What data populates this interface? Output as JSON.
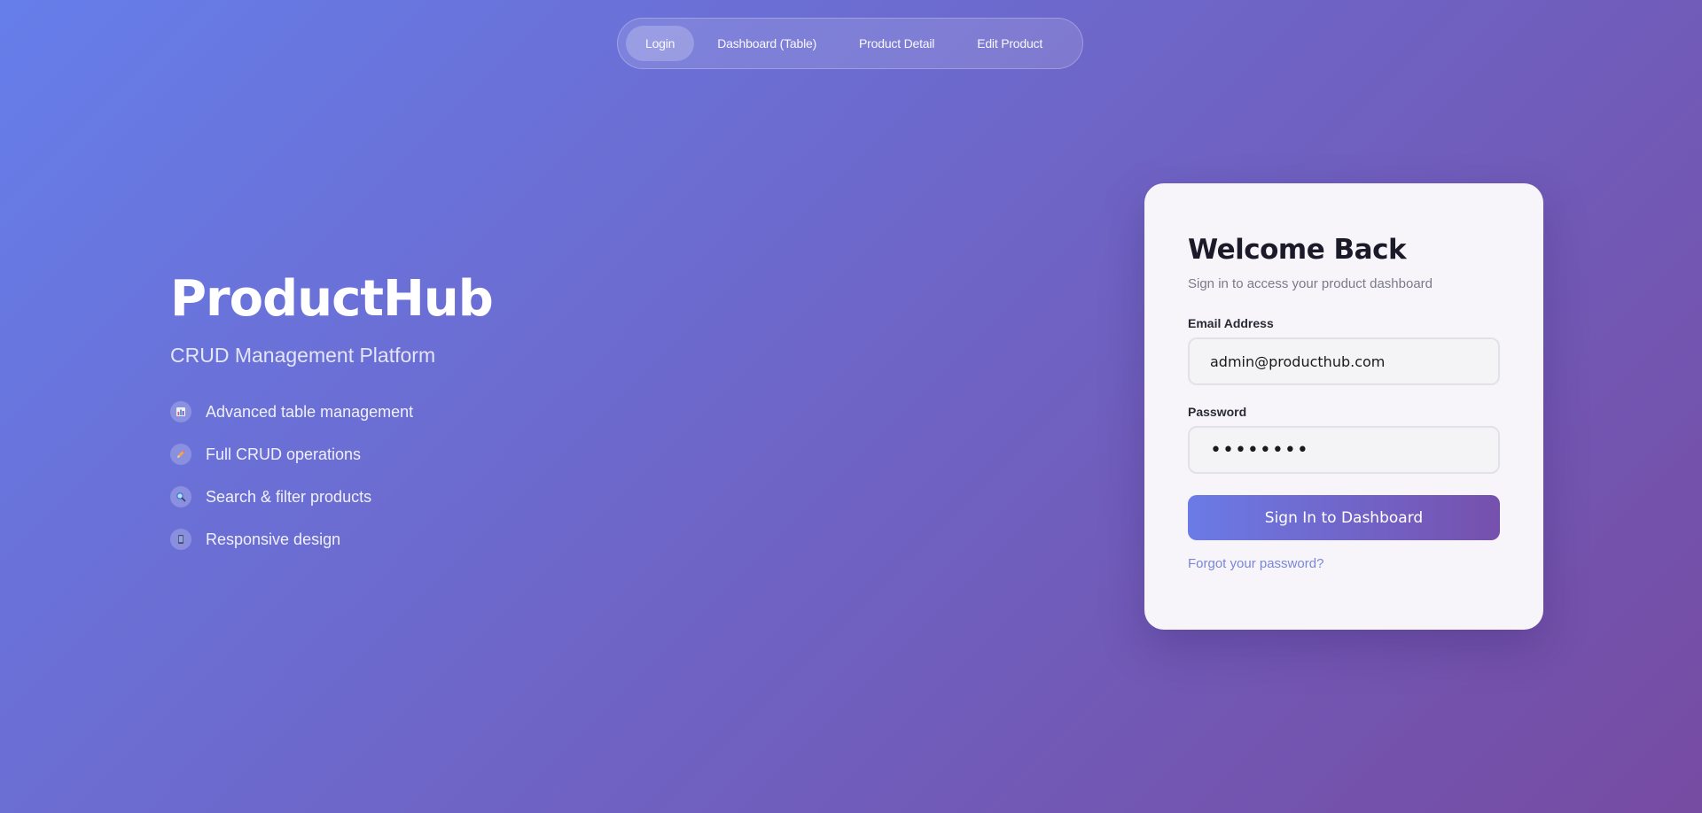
{
  "nav": {
    "items": [
      {
        "label": "Login",
        "active": true
      },
      {
        "label": "Dashboard (Table)",
        "active": false
      },
      {
        "label": "Product Detail",
        "active": false
      },
      {
        "label": "Edit Product",
        "active": false
      }
    ]
  },
  "hero": {
    "brand": "ProductHub",
    "tagline": "CRUD Management Platform",
    "features": [
      {
        "icon": "bar-chart-icon",
        "label": "Advanced table management"
      },
      {
        "icon": "pencil-icon",
        "label": "Full CRUD operations"
      },
      {
        "icon": "magnifier-icon",
        "label": "Search & filter products"
      },
      {
        "icon": "mobile-phone-icon",
        "label": "Responsive design"
      }
    ]
  },
  "login": {
    "title": "Welcome Back",
    "subtitle": "Sign in to access your product dashboard",
    "email_label": "Email Address",
    "email_value": "admin@producthub.com",
    "password_label": "Password",
    "password_value": "••••••••",
    "submit_label": "Sign In to Dashboard",
    "forgot_label": "Forgot your password?"
  },
  "colors": {
    "bg_start": "#667eea",
    "bg_end": "#764ba2",
    "link": "#7a86d8"
  }
}
